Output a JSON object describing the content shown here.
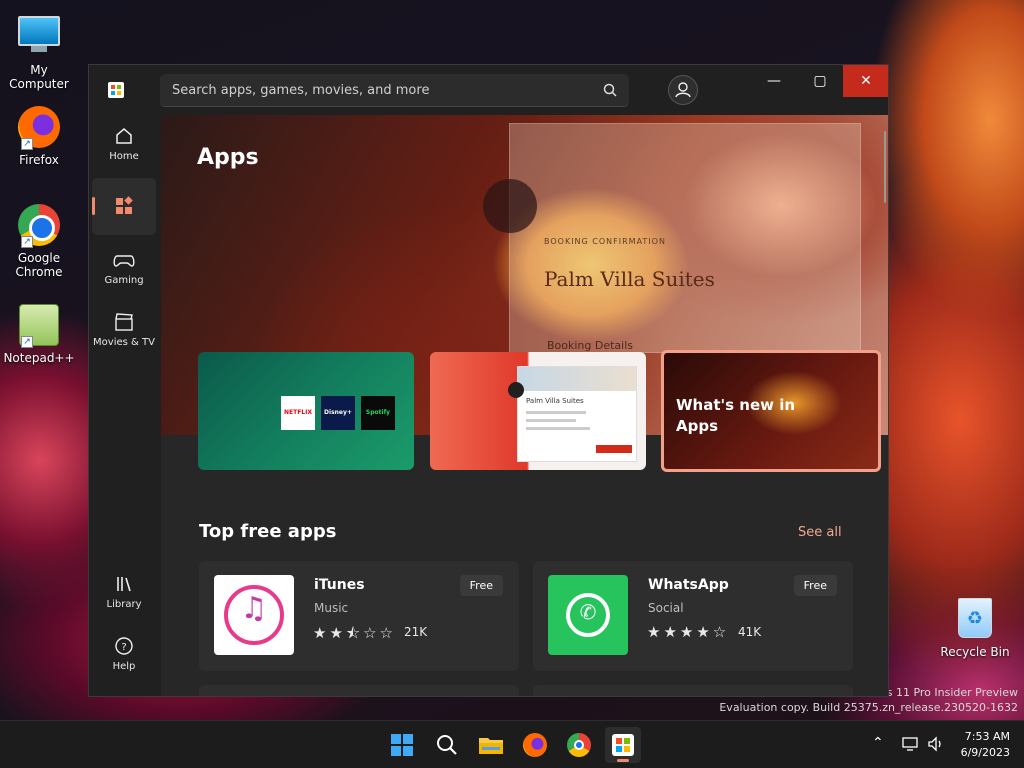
{
  "desktop": {
    "icons": [
      {
        "label": "My Computer"
      },
      {
        "label": "Firefox"
      },
      {
        "label": "Google Chrome"
      },
      {
        "label": "Notepad++"
      },
      {
        "label": "Recycle Bin"
      }
    ],
    "watermark": {
      "line1": "ws 11 Pro Insider Preview",
      "line2": "Evaluation copy. Build 25375.zn_release.230520-1632"
    }
  },
  "window": {
    "search_placeholder": "Search apps, games, movies, and more",
    "controls": {
      "minimize": "—",
      "maximize": "▢",
      "close": "✕"
    }
  },
  "sidebar": {
    "items": [
      {
        "label": "Home",
        "icon": "home-icon"
      },
      {
        "label": "",
        "icon": "apps-icon",
        "active": true
      },
      {
        "label": "Gaming",
        "icon": "gamepad-icon"
      },
      {
        "label": "Movies & TV",
        "icon": "clapperboard-icon"
      },
      {
        "label": "Library",
        "icon": "library-icon"
      },
      {
        "label": "Help",
        "icon": "help-icon"
      }
    ]
  },
  "hero": {
    "title": "Apps",
    "booking_label": "BOOKING CONFIRMATION",
    "hotel_name": "Palm Villa Suites",
    "details_label": "Booking Details"
  },
  "cards": [
    {
      "type": "streaming",
      "logos": [
        "NETFLIX",
        "Disney+",
        "Spotify"
      ]
    },
    {
      "type": "screenshot",
      "title": "Palm Villa Suites"
    },
    {
      "type": "feature",
      "title": "What's new in Apps"
    }
  ],
  "top_free": {
    "title": "Top free apps",
    "see_all": "See all",
    "apps": [
      {
        "name": "iTunes",
        "category": "Music",
        "rating": 2.5,
        "stars": "★★⯪☆☆",
        "count": "21K",
        "price": "Free"
      },
      {
        "name": "WhatsApp",
        "category": "Social",
        "rating": 4,
        "stars": "★★★★☆",
        "count": "41K",
        "price": "Free"
      }
    ]
  },
  "taskbar": {
    "time": "7:53 AM",
    "date": "6/9/2023",
    "items": [
      "start",
      "search",
      "file-explorer",
      "firefox",
      "chrome",
      "microsoft-store"
    ]
  },
  "colors": {
    "accent": "#f28b6b",
    "close_red": "#c42b1c",
    "window_bg": "#202020"
  }
}
